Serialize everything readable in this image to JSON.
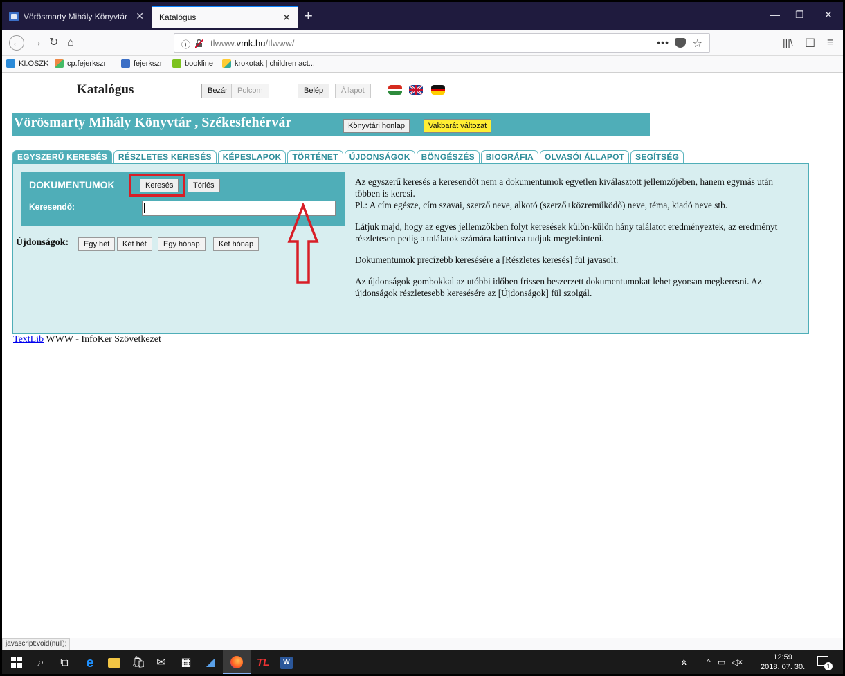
{
  "browser": {
    "tabs": [
      {
        "title": "Vörösmarty Mihály Könyvtár",
        "active": false
      },
      {
        "title": "Katalógus",
        "active": true
      }
    ],
    "url_prefix": "tlwww.",
    "url_domain": "vmk.hu",
    "url_path": "/tlwww/",
    "bookmarks": [
      "KI.OSZK",
      "cp.fejerkszr",
      "fejerkszr",
      "bookline",
      "krokotak | children act..."
    ],
    "status_text": "javascript:void(null);"
  },
  "page": {
    "title": "Katalógus",
    "top_buttons": [
      {
        "label": "Bezár",
        "enabled": true
      },
      {
        "label": "Polcom",
        "enabled": false
      },
      {
        "label": "Belép",
        "enabled": true
      },
      {
        "label": "Állapot",
        "enabled": false
      }
    ],
    "banner": {
      "title": "Vörösmarty Mihály Könyvtár , Székesfehérvár",
      "home_button": "Könyvtári honlap",
      "accessible_button": "Vakbarát változat"
    },
    "tabs": [
      "EGYSZERŰ KERESÉS",
      "RÉSZLETES KERESÉS",
      "KÉPESLAPOK",
      "TÖRTÉNET",
      "ÚJDONSÁGOK",
      "BÖNGÉSZÉS",
      "BIOGRÁFIA",
      "OLVASÓI ÁLLAPOT",
      "SEGÍTSÉG"
    ],
    "active_tab": "EGYSZERŰ KERESÉS",
    "search": {
      "section_title": "DOKUMENTUMOK",
      "search_button": "Keresés",
      "clear_button": "Törlés",
      "field_label": "Keresendő:",
      "field_value": ""
    },
    "news": {
      "label": "Újdonságok:",
      "buttons": [
        "Egy hét",
        "Két hét",
        "Egy hónap",
        "Két hónap"
      ]
    },
    "help_paragraphs": [
      "Az egyszerű keresés a keresendőt nem a dokumentumok egyetlen kiválasztott jellemzőjében, hanem egymás után többen is keresi.",
      "Pl.: A cím egésze, cím szavai, szerző neve, alkotó (szerző+közreműködő) neve, téma, kiadó neve stb.",
      "Látjuk majd, hogy az egyes jellemzőkben folyt keresések külön-külön hány találatot eredményeztek, az eredményt részletesen pedig a találatok számára kattintva tudjuk megtekinteni.",
      "Dokumentumok precízebb keresésére a [Részletes keresés] fül javasolt.",
      "Az újdonságok gombokkal az utóbbi időben frissen beszerzett dokumentumokat lehet gyorsan megkeresni. Az újdonságok részletesebb keresésére az [Újdonságok] fül szolgál."
    ],
    "footer_link": "TextLib",
    "footer_text": " WWW - InfoKer Szövetkezet"
  },
  "taskbar": {
    "time": "12:59",
    "date": "2018. 07. 30.",
    "notifications": "1"
  },
  "colors": {
    "accent": "#4faeb8",
    "panel": "#d8eef0",
    "highlight": "#d81e27",
    "yellow_button": "#ffee33"
  }
}
